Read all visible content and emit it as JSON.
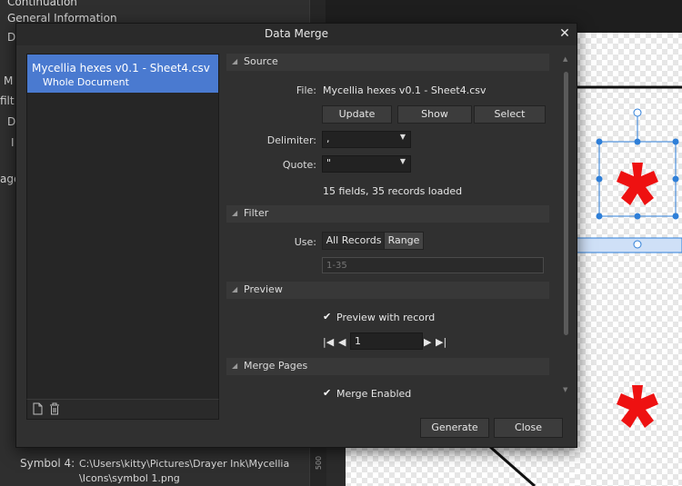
{
  "background": {
    "left_lines": [
      "Continuation",
      "General Information",
      "D",
      "M",
      "filt",
      "D",
      "I",
      "age"
    ],
    "symbol_label": "Symbol 4:",
    "symbol_path_line1": "C:\\Users\\kitty\\Pictures\\Drayer Ink\\Mycellia",
    "symbol_path_line2": "\\Icons\\symbol 1.png",
    "ruler_label": "500"
  },
  "dialog": {
    "title": "Data Merge",
    "close_glyph": "✕",
    "file_list": {
      "item_name": "Mycellia hexes v0.1 - Sheet4.csv",
      "item_scope": "Whole Document"
    },
    "sections": {
      "source": "Source",
      "filter": "Filter",
      "preview": "Preview",
      "merge_pages": "Merge Pages"
    },
    "source": {
      "file_label": "File:",
      "file_value": "Mycellia hexes v0.1 - Sheet4.csv",
      "update_label": "Update",
      "show_label": "Show",
      "select_label": "Select",
      "delimiter_label": "Delimiter:",
      "delimiter_value": ",",
      "quote_label": "Quote:",
      "quote_value": "\"",
      "status": "15 fields, 35 records loaded"
    },
    "filter": {
      "use_label": "Use:",
      "all_records_label": "All Records",
      "range_label": "Range",
      "range_placeholder": "1-35"
    },
    "preview": {
      "preview_checked": true,
      "preview_label": "Preview with record",
      "record_value": "1"
    },
    "merge_pages": {
      "merge_checked": true,
      "merge_label": "Merge Enabled"
    },
    "generate_label": "Generate",
    "close_label": "Close"
  },
  "colors": {
    "accent": "#4a7ad0",
    "canvas_shape": "#ee1111",
    "selection": "#2f7fd8"
  },
  "icons": [
    "new-document-icon",
    "trash-icon",
    "close-icon",
    "first-record-icon",
    "previous-record-icon",
    "next-record-icon",
    "last-record-icon",
    "checkmark-icon",
    "chevron-down-icon",
    "collapse-triangle-icon"
  ]
}
